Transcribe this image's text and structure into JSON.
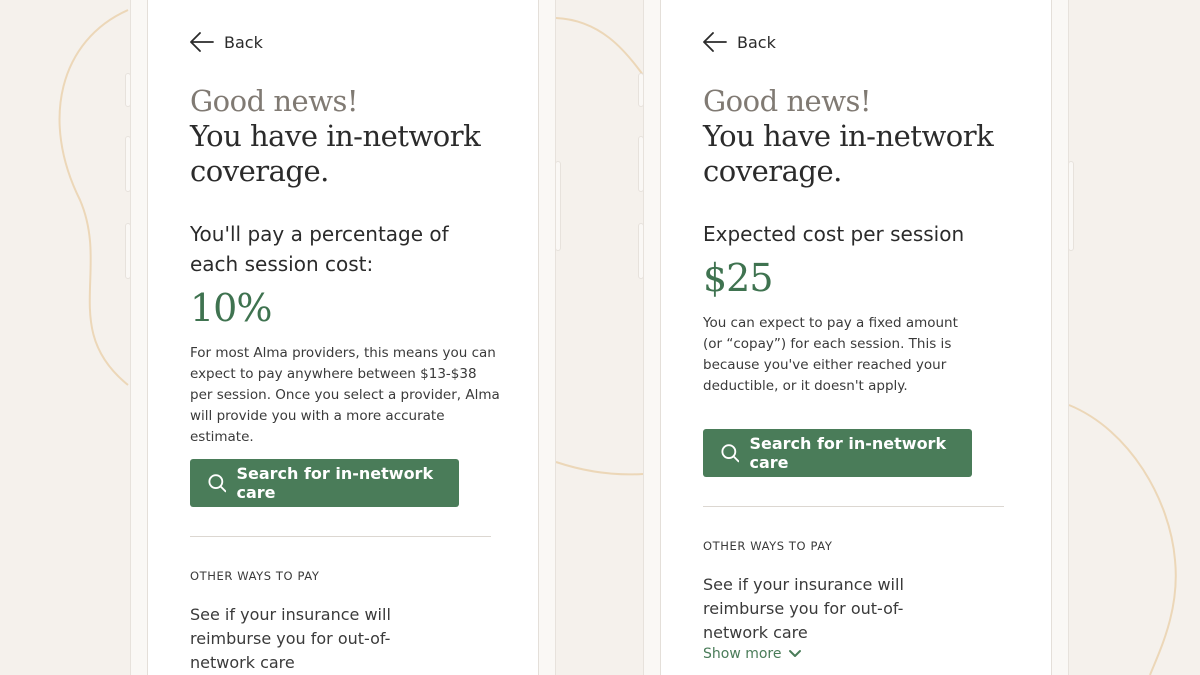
{
  "left_card": {
    "back_label": "Back",
    "headline_line1": "Good news!",
    "headline_line2": "You have in-network coverage.",
    "subhead": "You'll pay a percentage of each session cost:",
    "big_value": "10%",
    "body": "For most Alma providers, this means you can expect to pay anywhere between $13-$38 per session. Once you select a provider, Alma will provide you with a more accurate estimate.",
    "button_label": "Search for in-network care",
    "section_label": "OTHER WAYS TO PAY",
    "other_text": "See if your insurance will reimburse you for out-of-network care"
  },
  "right_card": {
    "back_label": "Back",
    "headline_line1": "Good news!",
    "headline_line2": "You have in-network coverage.",
    "subhead": "Expected cost per session",
    "big_value": "$25",
    "body": "You can expect to pay a fixed amount (or “copay”) for each session. This is because you've either reached your deductible, or it doesn't apply.",
    "button_label": "Search for in-network care",
    "section_label": "OTHER WAYS TO PAY",
    "other_text": "See if your insurance will reimburse you for out-of-network care",
    "show_more_label": "Show more"
  },
  "icons": {
    "back": "arrow-left-icon",
    "search": "search-icon",
    "chevron": "chevron-down-icon"
  },
  "colors": {
    "background": "#f5f1ec",
    "accent_green": "#4a7c59",
    "value_green": "#3f7350",
    "muted_text": "#807a73",
    "decor_line": "#ecd7b8"
  }
}
